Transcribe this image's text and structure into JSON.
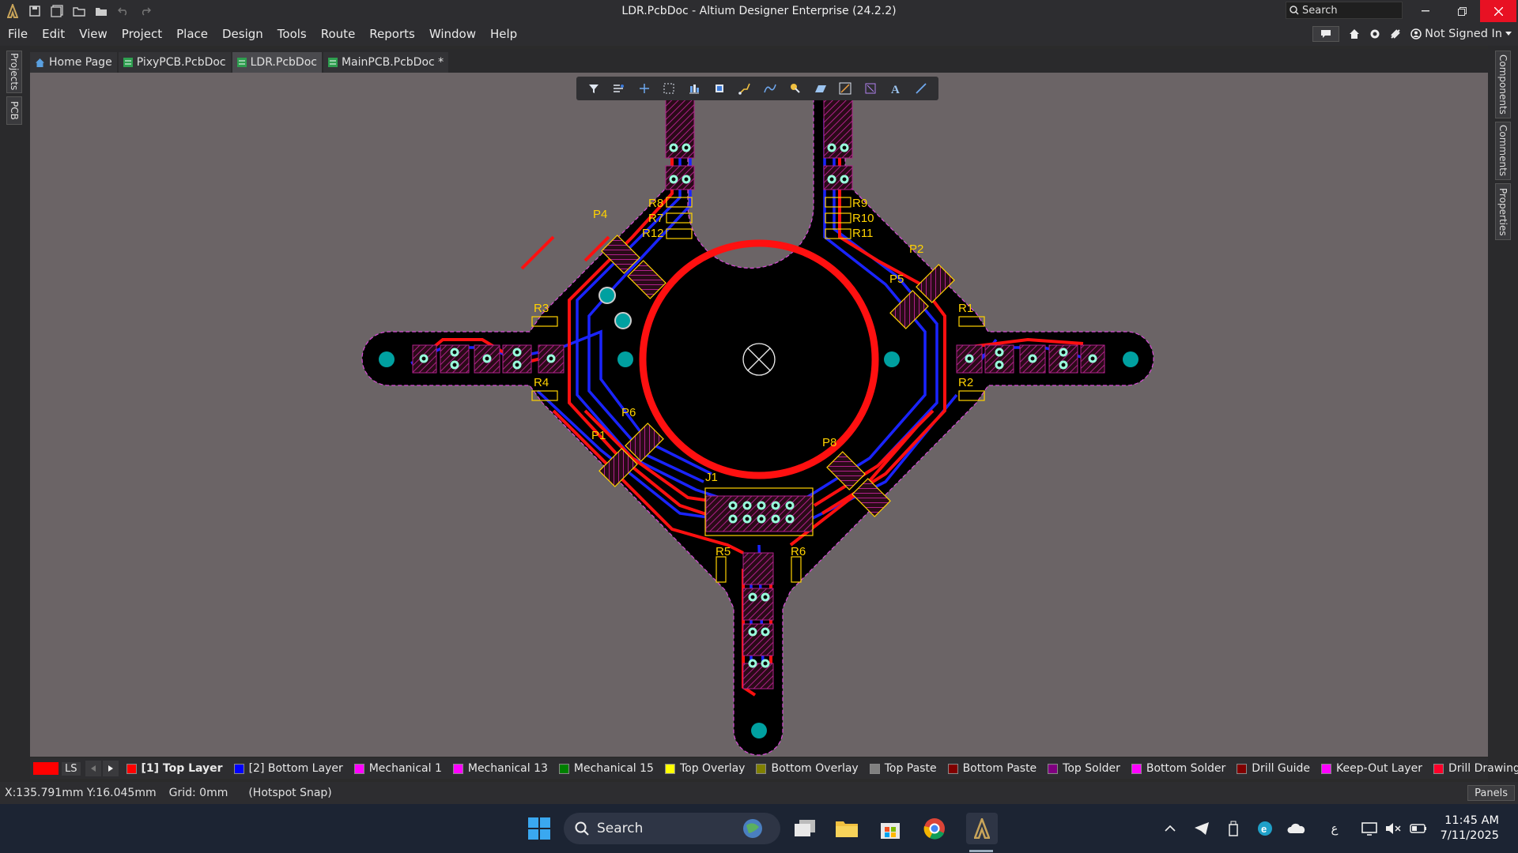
{
  "window": {
    "title": "LDR.PcbDoc - Altium Designer Enterprise (24.2.2)",
    "search_placeholder": "Search"
  },
  "menu": [
    "File",
    "Edit",
    "View",
    "Project",
    "Place",
    "Design",
    "Tools",
    "Route",
    "Reports",
    "Window",
    "Help"
  ],
  "account": "Not Signed In",
  "left_panels": [
    "Projects",
    "PCB"
  ],
  "right_panels": [
    "Components",
    "Comments",
    "Properties"
  ],
  "doc_tabs": [
    {
      "label": "Home Page",
      "active": false
    },
    {
      "label": "PixyPCB.PcbDoc",
      "active": false
    },
    {
      "label": "LDR.PcbDoc",
      "active": true
    },
    {
      "label": "MainPCB.PcbDoc *",
      "active": false
    }
  ],
  "pcb": {
    "designators": [
      "P4",
      "P2",
      "P5",
      "P6",
      "P1",
      "P8",
      "J1",
      "R1",
      "R2",
      "R3",
      "R4",
      "R5",
      "R6",
      "R7",
      "R8",
      "R9",
      "R10",
      "R11",
      "R12"
    ],
    "board_color": "#000000",
    "top_trace_color": "#ff0000",
    "bottom_trace_color": "#0000ff",
    "overlay_color": "#ffff00",
    "background_color": "#6b6466"
  },
  "layer_set": {
    "label": "LS",
    "color": "#ff0000"
  },
  "layers": [
    {
      "label": "[1] Top Layer",
      "color": "#ff0000",
      "active": true
    },
    {
      "label": "[2] Bottom Layer",
      "color": "#0000ff",
      "active": false
    },
    {
      "label": "Mechanical 1",
      "color": "#ff00ff",
      "active": false
    },
    {
      "label": "Mechanical 13",
      "color": "#ff00ff",
      "active": false
    },
    {
      "label": "Mechanical 15",
      "color": "#008000",
      "active": false
    },
    {
      "label": "Top Overlay",
      "color": "#ffff00",
      "active": false
    },
    {
      "label": "Bottom Overlay",
      "color": "#808000",
      "active": false
    },
    {
      "label": "Top Paste",
      "color": "#808080",
      "active": false
    },
    {
      "label": "Bottom Paste",
      "color": "#800000",
      "active": false
    },
    {
      "label": "Top Solder",
      "color": "#800080",
      "active": false
    },
    {
      "label": "Bottom Solder",
      "color": "#ff00ff",
      "active": false
    },
    {
      "label": "Drill Guide",
      "color": "#800000",
      "active": false
    },
    {
      "label": "Keep-Out Layer",
      "color": "#ff00ff",
      "active": false
    },
    {
      "label": "Drill Drawing",
      "color": "#ff002a",
      "active": false
    }
  ],
  "status": {
    "coords": "X:135.791mm Y:16.045mm",
    "grid": "Grid: 0mm",
    "snap": "(Hotspot Snap)",
    "panels": "Panels"
  },
  "taskbar": {
    "search": "Search",
    "time": "11:45 AM",
    "date": "7/11/2025",
    "lang": "ع"
  }
}
